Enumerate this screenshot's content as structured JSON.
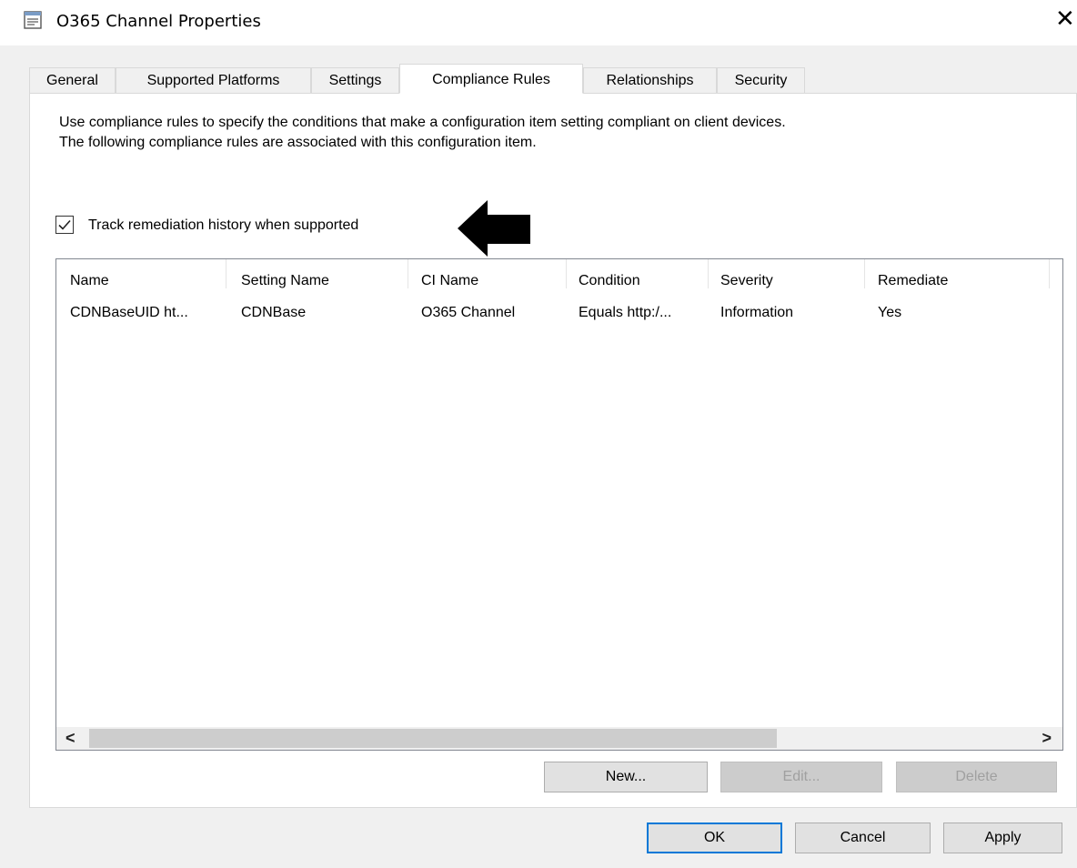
{
  "window": {
    "title": "O365 Channel Properties",
    "close_glyph": "✕",
    "icon": "properties-window-icon"
  },
  "tabs": [
    {
      "label": "General",
      "active": false
    },
    {
      "label": "Supported Platforms",
      "active": false
    },
    {
      "label": "Settings",
      "active": false
    },
    {
      "label": "Compliance Rules",
      "active": true
    },
    {
      "label": "Relationships",
      "active": false
    },
    {
      "label": "Security",
      "active": false
    }
  ],
  "compliance": {
    "description_line1": "Use compliance rules to specify the conditions that make a configuration item setting compliant on client devices.",
    "description_line2": "The following compliance rules are associated with this configuration item.",
    "track_history_label": "Track remediation history when supported",
    "track_history_checked": true
  },
  "rules_table": {
    "columns": [
      "Name",
      "Setting Name",
      "CI Name",
      "Condition",
      "Severity",
      "Remediate"
    ],
    "rows": [
      [
        "CDNBaseUID ht...",
        "CDNBase",
        "O365 Channel",
        "Equals  http:/...",
        "Information",
        "Yes"
      ]
    ]
  },
  "list_buttons": {
    "new": "New...",
    "edit": "Edit...",
    "delete": "Delete",
    "edit_enabled": false,
    "delete_enabled": false
  },
  "dialog_buttons": {
    "ok": "OK",
    "cancel": "Cancel",
    "apply": "Apply"
  },
  "scrollbar": {
    "left_glyph": "<",
    "right_glyph": ">"
  },
  "colors": {
    "focus_border": "#0078d7",
    "dialog_background": "#f0f0f0"
  }
}
